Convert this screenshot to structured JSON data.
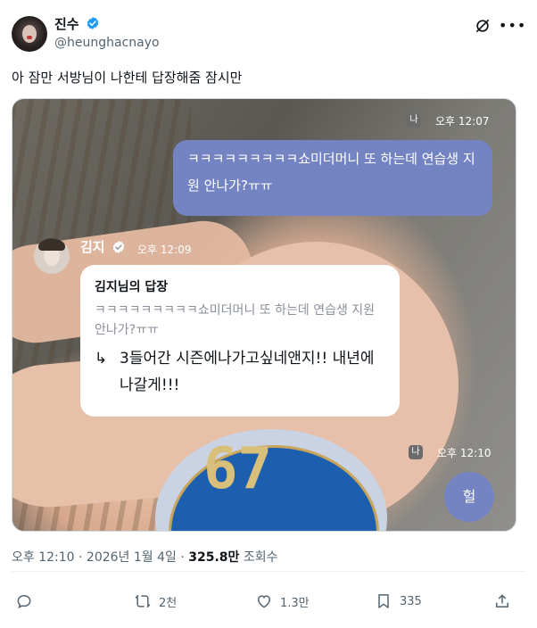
{
  "author": {
    "display_name": "진수",
    "handle": "@heunghacnayo",
    "verified": true,
    "accent_color": "#1d9bf0"
  },
  "header_icons": [
    "grok-icon",
    "more-icon"
  ],
  "tweet": {
    "text": "아 잠만 서방님이 나한테 답장해줌 잠시만"
  },
  "media": {
    "me_label": "나",
    "msg1_time": "오후 12:07",
    "msg1_text": "ㅋㅋㅋㅋㅋㅋㅋㅋㅋ쇼미더머니 또 하는데 연습생 지원 안나가?ㅠㅠ",
    "reply_author": "김지",
    "reply_time": "오후 12:09",
    "reply_card_title": "김지님의 답장",
    "reply_quote": "ㅋㅋㅋㅋㅋㅋㅋㅋㅋ쇼미더머니 또 하는데 연습생 지원 안나가?ㅠㅠ",
    "reply_arrow": "↳",
    "reply_text": "3들어간 시즌에나가고싶네앤지!! 내년에나갈게!!!",
    "chip_number": "67",
    "msg2_time": "오후 12:10",
    "msg2_text": "헐",
    "bubble_color": "#7484c2"
  },
  "meta": {
    "time": "오후 12:10",
    "sep1": "·",
    "date": "2026년 1월 4일",
    "sep2": "·",
    "views": "325.8만",
    "views_label": "조회수"
  },
  "actions": {
    "reply_count": "",
    "retweet_count": "2천",
    "like_count": "1.3만",
    "bookmark_count": "335"
  }
}
